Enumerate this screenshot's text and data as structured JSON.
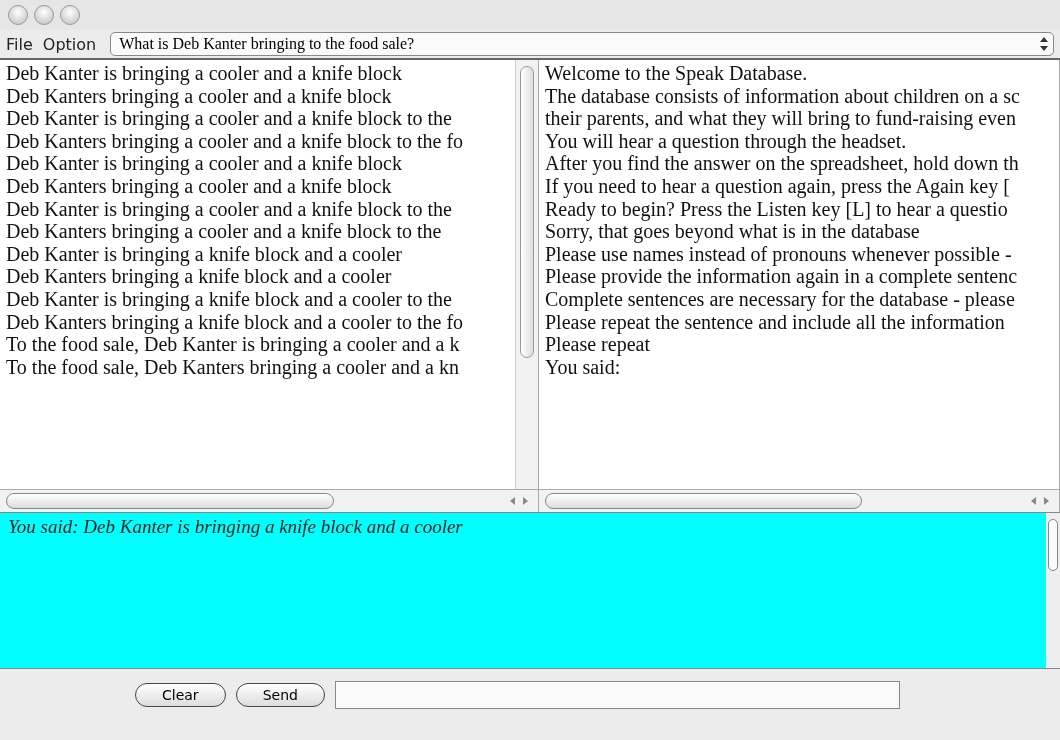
{
  "menu": [
    "File",
    "Option"
  ],
  "question_select": {
    "value": "What is Deb Kanter bringing to the food sale?"
  },
  "sentences": [
    "Deb Kanter is bringing a cooler and a knife block",
    "Deb Kanters bringing a cooler and a knife block",
    "Deb Kanter is bringing a cooler and a knife block to the",
    "Deb Kanters bringing a cooler and a knife block to the fo",
    "Deb Kanter is bringing a cooler and a knife block",
    "Deb Kanters bringing  a cooler and a knife block",
    "Deb Kanter is bringing a cooler and a knife block to the",
    "Deb Kanters bringing a cooler and  a knife block to the",
    "Deb Kanter is bringing a knife block and a cooler",
    "Deb Kanters bringing a knife block and a cooler",
    "Deb Kanter is bringing a knife block and a cooler to the",
    "Deb Kanters bringing a knife block and a cooler to the fo",
    "To the food sale, Deb Kanter is bringing a cooler and a k",
    "To the food sale, Deb Kanters bringing a cooler and a kn"
  ],
  "messages": [
    "Welcome to the Speak Database.",
    "The database consists of information about children on a sc",
    "their parents, and what they will bring to fund-raising even",
    "You will hear a question through the headset.",
    "After you find the answer on the spreadsheet, hold down th",
    "If you need to hear a question again, press the Again key [",
    "Ready to begin?  Press the Listen key [L] to hear a questio",
    "Sorry, that goes beyond what is in the database",
    "Please use names instead of pronouns whenever possible -",
    "Please provide the information again in a complete sentenc",
    "Complete sentences are necessary for the database - please",
    "Please repeat the sentence and include all the information",
    "Please repeat",
    "You said:"
  ],
  "transcript": "You said: Deb Kanter is bringing a knife block and a cooler",
  "buttons": [
    "Clear",
    "Send"
  ]
}
